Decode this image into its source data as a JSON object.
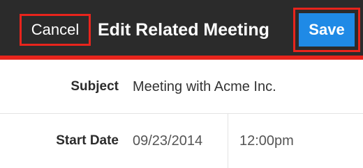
{
  "header": {
    "cancel_label": "Cancel",
    "title": "Edit Related Meeting",
    "save_label": "Save",
    "background_color": "#2b2b2b",
    "accent_color": "#e8241c",
    "save_color": "#1f8ae6"
  },
  "form": {
    "subject": {
      "label": "Subject",
      "value": "Meeting with Acme Inc."
    },
    "start_date": {
      "label": "Start Date",
      "date": "09/23/2014",
      "time": "12:00pm"
    }
  }
}
